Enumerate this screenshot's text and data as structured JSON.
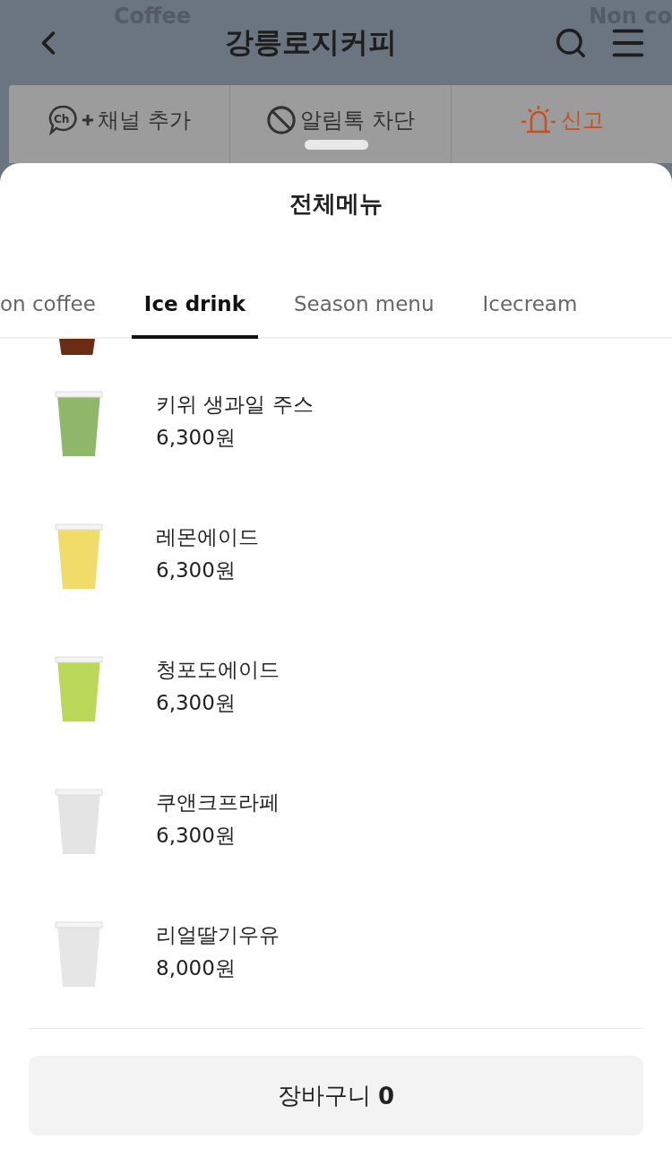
{
  "background_tabs": [
    "Coffee",
    "Non co"
  ],
  "header": {
    "title": "강릉로지커피"
  },
  "actions": [
    {
      "kind": "channel",
      "icon_text": "Ch",
      "label": "채널 추가"
    },
    {
      "kind": "block",
      "label": "알림톡 차단"
    },
    {
      "kind": "report",
      "label": "신고"
    }
  ],
  "sheet": {
    "title": "전체메뉴",
    "tabs": [
      {
        "label": "on coffee",
        "selected": false
      },
      {
        "label": "Ice drink",
        "selected": true
      },
      {
        "label": "Season menu",
        "selected": false
      },
      {
        "label": "Icecream",
        "selected": false
      }
    ],
    "items": [
      {
        "name": "키위 생과일 주스",
        "price": "6,300원",
        "color": "#8fb86a"
      },
      {
        "name": "레몬에이드",
        "price": "6,300원",
        "color": "#f1dc6a"
      },
      {
        "name": "청포도에이드",
        "price": "6,300원",
        "color": "#bcd85a"
      },
      {
        "name": "쿠앤크프라페",
        "price": "6,300원",
        "color": "#e4e4e4"
      },
      {
        "name": "리얼딸기우유",
        "price": "8,000원",
        "color": "#e6e6e6"
      }
    ],
    "cart": {
      "label": "장바구니",
      "count": "0"
    }
  }
}
